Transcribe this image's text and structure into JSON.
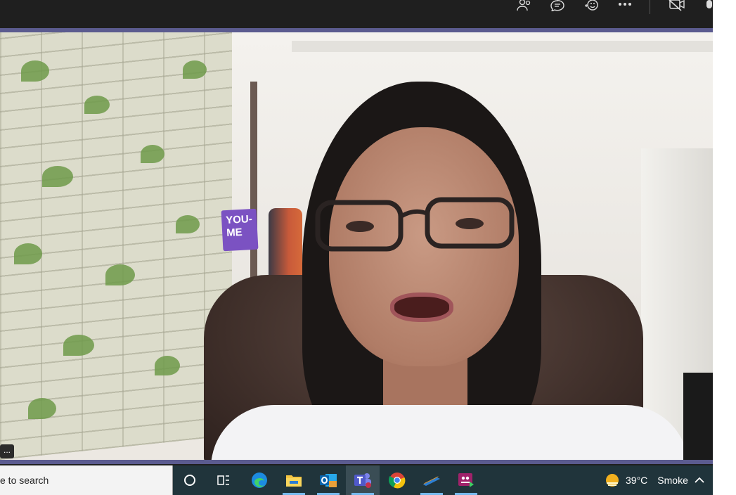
{
  "topbar": {
    "icons": [
      "people-icon",
      "chat-icon",
      "reactions-icon",
      "more-options-icon",
      "camera-off-icon",
      "microphone-icon"
    ]
  },
  "video": {
    "sign_text": "YOU-\nME",
    "more_label": "..."
  },
  "taskbar": {
    "search_placeholder": "e to search",
    "weather_temp": "39°C",
    "weather_desc": "Smoke",
    "apps": [
      "cortana-icon",
      "task-view-icon",
      "edge-icon",
      "file-explorer-icon",
      "outlook-icon",
      "teams-icon",
      "chrome-icon",
      "pen-app-icon",
      "screen-recorder-icon"
    ]
  },
  "colors": {
    "teams_bar": "#1f1f1f",
    "video_border": "#5b5b8f",
    "taskbar": "#20343b",
    "accent": "#76b9ed"
  }
}
